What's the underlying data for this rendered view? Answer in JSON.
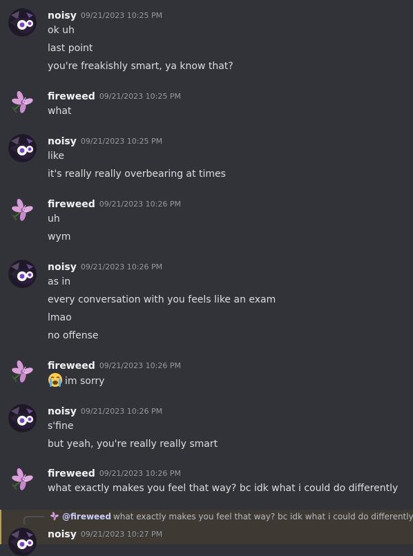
{
  "messages": [
    {
      "user": "noisy",
      "avatar": "noisy-avatar",
      "time": "09/21/2023 10:25 PM",
      "lines": [
        "ok uh",
        "last point",
        "you're freakishly smart, ya know that?"
      ]
    },
    {
      "user": "fireweed",
      "avatar": "fireweed-avatar",
      "time": "09/21/2023 10:25 PM",
      "lines": [
        "what"
      ]
    },
    {
      "user": "noisy",
      "avatar": "noisy-avatar",
      "time": "09/21/2023 10:25 PM",
      "lines": [
        "like",
        "it's really really overbearing at times"
      ]
    },
    {
      "user": "fireweed",
      "avatar": "fireweed-avatar",
      "time": "09/21/2023 10:26 PM",
      "lines": [
        "uh",
        "wym"
      ]
    },
    {
      "user": "noisy",
      "avatar": "noisy-avatar",
      "time": "09/21/2023 10:26 PM",
      "lines": [
        "as in",
        "every conversation with you feels like an exam",
        "lmao",
        "no offense"
      ]
    },
    {
      "user": "fireweed",
      "avatar": "fireweed-avatar",
      "time": "09/21/2023 10:26 PM",
      "lines": [
        "im sorry"
      ],
      "emoji": "loudly-crying-face-emoji"
    },
    {
      "user": "noisy",
      "avatar": "noisy-avatar",
      "time": "09/21/2023 10:26 PM",
      "lines": [
        "s'fine",
        "but yeah, you're really really smart"
      ]
    },
    {
      "user": "fireweed",
      "avatar": "fireweed-avatar",
      "time": "09/21/2023 10:26 PM",
      "lines": [
        "what exactly makes you feel that way? bc idk what i could do differently"
      ]
    },
    {
      "user": "noisy",
      "avatar": "noisy-avatar",
      "time": "09/21/2023 10:27 PM",
      "lines": [],
      "reply": {
        "mention": "@fireweed",
        "text": "what exactly makes you feel that way? bc idk what i could do differently"
      }
    }
  ],
  "colors": {
    "background": "#313338",
    "username": "#f2f3f5",
    "timestamp": "#949ba4",
    "message_text": "#dbdee1",
    "highlight_bg": "#3e3a33",
    "mention": "#c9cdfb"
  }
}
